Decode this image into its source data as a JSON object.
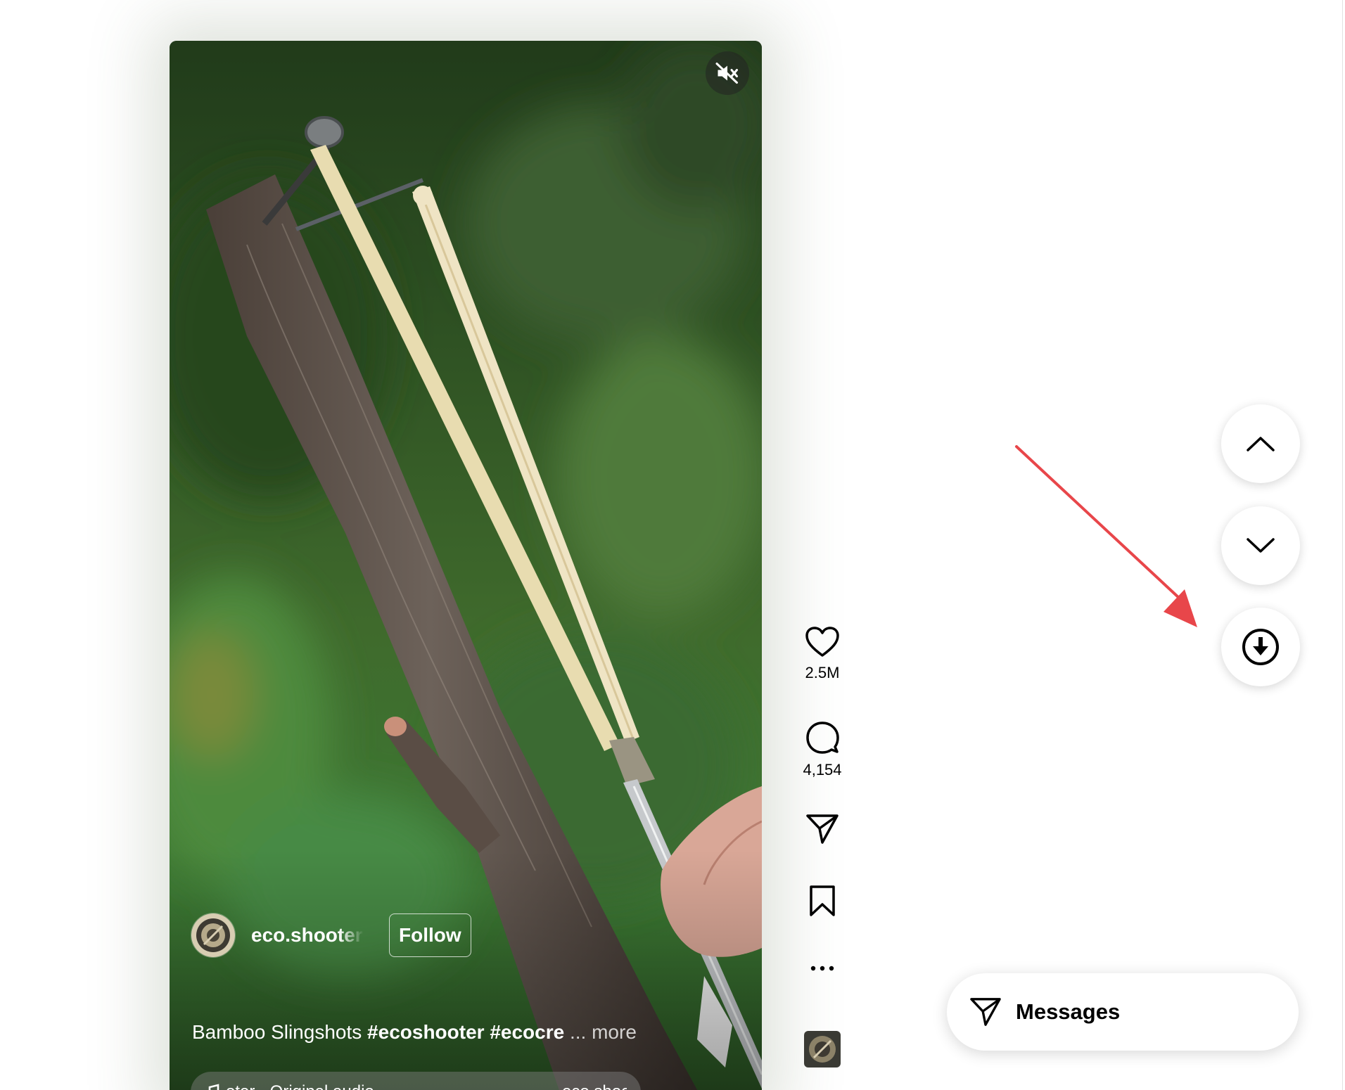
{
  "reel": {
    "author": {
      "username": "eco.shooter",
      "follow_label": "Follow"
    },
    "caption": {
      "text": "Bamboo Slingshots ",
      "hashtags": "#ecoshooter #ecocre",
      "ellipsis": " ... ",
      "more_label": "more"
    },
    "audio": {
      "title": "oter · Original audio",
      "username": "eco.shooter"
    },
    "mute_icon": "speaker-muted-icon"
  },
  "actions": {
    "like": {
      "icon": "heart-icon",
      "count": "2.5M"
    },
    "comment": {
      "icon": "comment-icon",
      "count": "4,154"
    },
    "share": {
      "icon": "paper-plane-icon"
    },
    "save": {
      "icon": "bookmark-icon"
    },
    "more": {
      "icon": "more-horizontal-icon"
    }
  },
  "navigation": {
    "previous_icon": "chevron-up-icon",
    "next_icon": "chevron-down-icon",
    "download_icon": "download-circle-icon"
  },
  "messages": {
    "label": "Messages",
    "icon": "paper-plane-icon"
  },
  "colors": {
    "annotation_arrow": "#e8464a",
    "icon": "#000000",
    "page_background": "#ffffff"
  }
}
